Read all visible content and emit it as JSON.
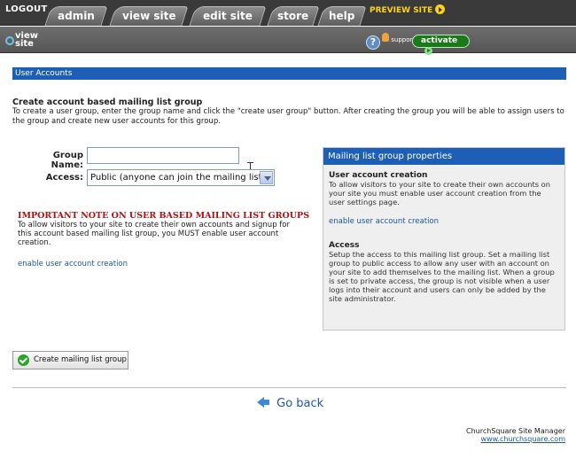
{
  "topbar": {
    "logout": "LOGOUT",
    "tabs": [
      "admin",
      "view site",
      "edit site",
      "store",
      "help"
    ],
    "preview": "PREVIEW SITE"
  },
  "subbar": {
    "view_site": [
      "view",
      "site"
    ],
    "support": "support",
    "activate": "activate"
  },
  "section": {
    "title": "User Accounts"
  },
  "create": {
    "heading": "Create account based mailing list group",
    "description": "To create a user group, enter the group name and click the \"create user group\" button. After creating the group you will be able to assign users to the group and create new user accounts for this group."
  },
  "form": {
    "group_name_label": "Group Name:",
    "group_name_value": "",
    "access_label": "Access:",
    "access_selected": "Public (anyone can join the mailing list)"
  },
  "note": {
    "title": "IMPORTANT NOTE ON USER BASED MAILING LIST GROUPS",
    "text": "To allow visitors to your site to create their own accounts and signup for this account based mailing list group, you MUST enable user account creation.",
    "link": "enable user account creation"
  },
  "panel": {
    "title": "Mailing list group properties",
    "s1_heading": "User account creation",
    "s1_text": "To allow visitors to your site to create their own accounts on your site you must enable user account creation from the user settings page.",
    "s1_link": "enable user account creation",
    "s2_heading": "Access",
    "s2_text": "Setup the access to this mailing list group. Set a mailing list group to public access to allow any user with an account on your site to add themselves to the mailing list. When a group is set to private access, the group is not visible when a user logs into their account and users can only be added by the site administrator."
  },
  "actions": {
    "create_button": "Create mailing list group",
    "go_back": "Go back"
  },
  "footer": {
    "line1": "ChurchSquare Site Manager",
    "line2": "www.churchsquare.com"
  },
  "colors": {
    "accent_blue": "#1d5fb6",
    "note_red": "#b40f0f",
    "activate_green": "#1a7a1a"
  }
}
